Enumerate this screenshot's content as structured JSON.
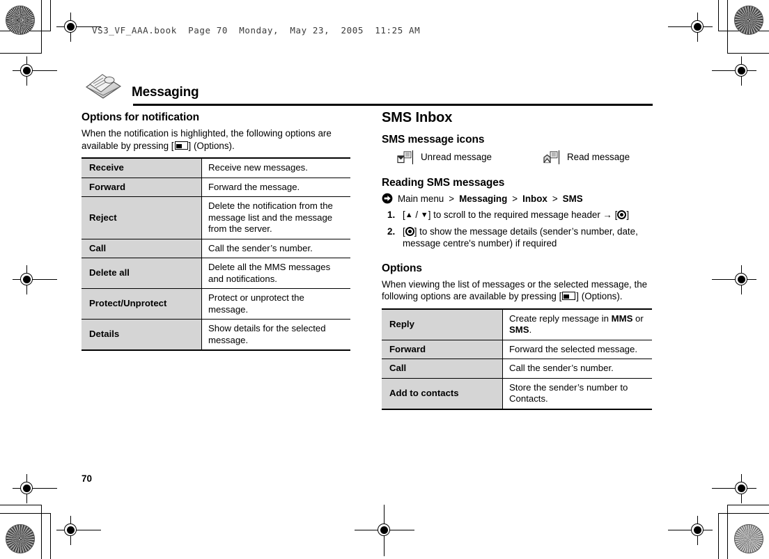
{
  "print": {
    "file_header": "VS3_VF_AAA.book  Page 70  Monday,  May 23,  2005  11:25 AM",
    "page_number": "70"
  },
  "chapter": {
    "title": "Messaging",
    "icon": "envelope-mail-icon"
  },
  "left_column": {
    "heading": "Options for notification",
    "intro_before": "When the notification is highlighted, the following options are available by pressing [",
    "intro_after": "] (Options).",
    "table": {
      "rows": [
        {
          "key": "Receive",
          "value": "Receive new messages."
        },
        {
          "key": "Forward",
          "value": "Forward the message."
        },
        {
          "key": "Reject",
          "value": "Delete the notification from the message list and the message from the server."
        },
        {
          "key": "Call",
          "value": "Call the sender’s number."
        },
        {
          "key": "Delete all",
          "value": "Delete all the MMS messages and notifications."
        },
        {
          "key": "Protect/Unprotect",
          "value": "Protect or unprotect the message."
        },
        {
          "key": "Details",
          "value": "Show details for the selected message."
        }
      ]
    }
  },
  "right_column": {
    "heading": "SMS Inbox",
    "icons_heading": "SMS message icons",
    "icons": [
      {
        "icon": "unread-message-envelope-icon",
        "label": "Unread message"
      },
      {
        "icon": "read-message-envelope-icon",
        "label": "Read message"
      }
    ],
    "reading_heading": "Reading SMS messages",
    "nav_path": {
      "arrow_icon": "arrow-circle-right-icon",
      "segments": [
        "Main menu",
        "Messaging",
        "Inbox",
        "SMS"
      ],
      "separator": ">",
      "bold_flags": [
        false,
        true,
        true,
        true
      ]
    },
    "steps": [
      {
        "num": "1.",
        "parts": {
          "p1": "[",
          "up": "▲",
          "slash": " / ",
          "down": "▼",
          "p2": "] to scroll to the required message header → [",
          "p3": "]"
        }
      },
      {
        "num": "2.",
        "parts": {
          "p1": "[",
          "p2": "] to show the message details (sender’s number, date, message centre's number) if required"
        }
      }
    ],
    "options_heading": "Options",
    "options_intro_before": "When viewing the list of messages or the selected message, the following options are available by pressing [",
    "options_intro_after": "] (Options).",
    "table": {
      "rows": [
        {
          "key": "Reply",
          "value_before": "Create reply message in ",
          "value_bold1": "MMS",
          "value_mid": " or ",
          "value_bold2": "SMS",
          "value_after": "."
        },
        {
          "key": "Forward",
          "value": "Forward the selected message."
        },
        {
          "key": "Call",
          "value": "Call the sender’s number."
        },
        {
          "key": "Add to contacts",
          "value": "Store the sender’s number to Contacts."
        }
      ]
    }
  },
  "colors": {
    "table_key_bg": "#d5d5d5",
    "rule": "#000000",
    "text": "#000000"
  }
}
